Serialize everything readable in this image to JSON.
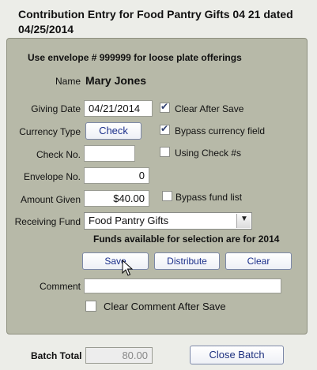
{
  "title": "Contribution Entry for Food Pantry Gifts 04 21 dated 04/25/2014",
  "notice": "Use envelope # 999999 for loose plate offerings",
  "name_label": "Name",
  "name_value": "Mary Jones",
  "giving_date_label": "Giving Date",
  "giving_date_value": "04/21/2014",
  "clear_after_save_label": "Clear After Save",
  "currency_type_label": "Currency Type",
  "currency_type_value": "Check",
  "bypass_currency_label": "Bypass currency field",
  "check_no_label": "Check No.",
  "check_no_value": "",
  "using_check_label": "Using Check #s",
  "envelope_no_label": "Envelope No.",
  "envelope_no_value": "0",
  "amount_given_label": "Amount Given",
  "amount_given_value": "$40.00",
  "bypass_fund_label": "Bypass fund list",
  "receiving_fund_label": "Receiving Fund",
  "receiving_fund_value": "Food Pantry Gifts",
  "funds_note": "Funds available for selection are for 2014",
  "save_label": "Save",
  "distribute_label": "Distribute",
  "clear_label": "Clear",
  "comment_label": "Comment",
  "comment_value": "",
  "clear_comment_label": "Clear Comment After Save",
  "batch_total_label": "Batch Total",
  "batch_total_value": "80.00",
  "close_batch_label": "Close Batch",
  "checkboxes": {
    "clear_after_save": true,
    "bypass_currency": true,
    "using_check": false,
    "bypass_fund": false,
    "clear_comment": false
  }
}
